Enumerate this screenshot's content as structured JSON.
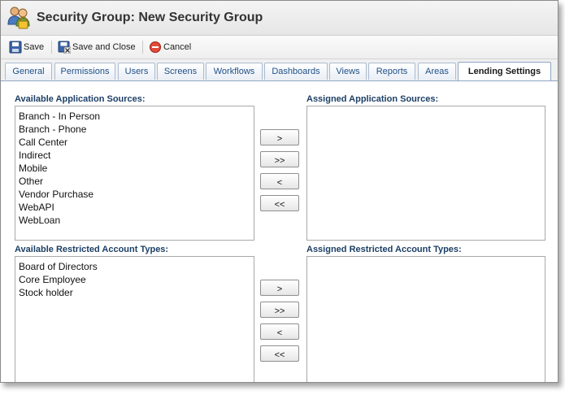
{
  "window": {
    "title": "Security Group: New Security Group"
  },
  "toolbar": {
    "save_label": "Save",
    "save_close_label": "Save and Close",
    "cancel_label": "Cancel"
  },
  "tabs": [
    {
      "label": "General"
    },
    {
      "label": "Permissions"
    },
    {
      "label": "Users"
    },
    {
      "label": "Screens"
    },
    {
      "label": "Workflows"
    },
    {
      "label": "Dashboards"
    },
    {
      "label": "Views"
    },
    {
      "label": "Reports"
    },
    {
      "label": "Areas"
    },
    {
      "label": "Lending Settings",
      "active": true
    }
  ],
  "app_sources": {
    "available_label": "Available Application Sources:",
    "assigned_label": "Assigned Application Sources:",
    "available_items": [
      "Branch - In Person",
      "Branch - Phone",
      "Call Center",
      "Indirect",
      "Mobile",
      "Other",
      "Vendor Purchase",
      "WebAPI",
      "WebLoan"
    ],
    "assigned_items": []
  },
  "account_types": {
    "available_label": "Available Restricted Account Types:",
    "assigned_label": "Assigned Restricted Account Types:",
    "available_items": [
      "Board of Directors",
      "Core Employee",
      "Stock holder"
    ],
    "assigned_items": []
  },
  "move_buttons": {
    "add": ">",
    "add_all": ">>",
    "remove": "<",
    "remove_all": "<<"
  },
  "colors": {
    "tab_text": "#1e4f86",
    "section_label": "#1c3f66",
    "tab_border": "#8fa6c4"
  },
  "icons": {
    "title": "security-group-icon",
    "save": "floppy-disk-icon",
    "save_close": "save-close-icon",
    "cancel": "cancel-icon"
  }
}
